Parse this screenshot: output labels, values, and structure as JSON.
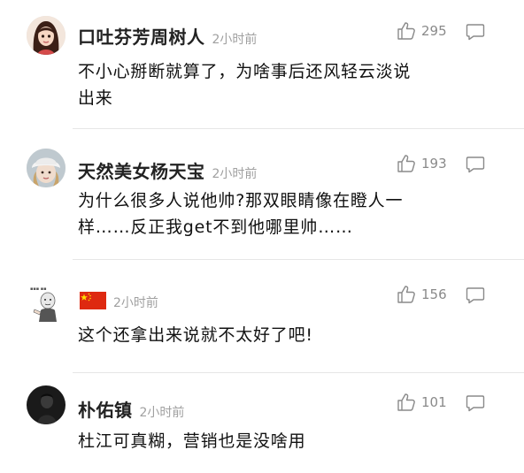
{
  "comments": [
    {
      "name": "口吐芬芳周树人",
      "time": "2小时前",
      "likes": "295",
      "text_line1": "不小心掰断就算了，为啥事后还风轻云淡说",
      "text_line2": "出来",
      "avatar": "avatar-girl-dark-hair-icon"
    },
    {
      "name": "天然美女杨天宝",
      "time": "2小时前",
      "likes": "193",
      "text_line1": "为什么很多人说他帅?那双眼睛像在瞪人一",
      "text_line2": "样……反正我get不到他哪里帅……",
      "avatar": "avatar-hat-photo-icon"
    },
    {
      "name": "",
      "time": "2小时前",
      "likes": "156",
      "text_line1": "这个还拿出来说就不太好了吧!",
      "text_line2": "",
      "avatar": "avatar-meme-figure-icon",
      "flag": "china-flag-icon"
    },
    {
      "name": "朴佑镇",
      "time": "2小时前",
      "likes": "101",
      "text_line1": "杜江可真糊，营销也是没啥用",
      "text_line2": "",
      "avatar": "avatar-dark-photo-icon"
    }
  ],
  "colors": {
    "name": "#222222",
    "time": "#a0a0a0",
    "count": "#8a8a8a",
    "divider": "#e6e6e6",
    "flag_red": "#de2910",
    "flag_yellow": "#ffde00"
  },
  "icons": {
    "like": "thumbs-up-icon",
    "reply": "comment-bubble-icon"
  }
}
